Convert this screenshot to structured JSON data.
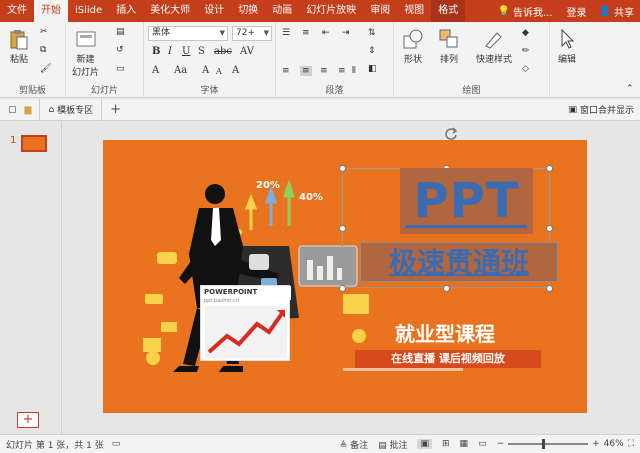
{
  "tabs": [
    {
      "label": "文件",
      "active": false
    },
    {
      "label": "开始",
      "active": true
    },
    {
      "label": "iSlide",
      "active": false
    },
    {
      "label": "插入",
      "active": false
    },
    {
      "label": "美化大师",
      "active": false
    },
    {
      "label": "设计",
      "active": false
    },
    {
      "label": "切换",
      "active": false
    },
    {
      "label": "动画",
      "active": false
    },
    {
      "label": "幻灯片放映",
      "active": false
    },
    {
      "label": "审阅",
      "active": false
    },
    {
      "label": "视图",
      "active": false
    },
    {
      "label": "格式",
      "active": false
    }
  ],
  "tell_me": "告诉我...",
  "sign_in": "登录",
  "share": "共享",
  "ribbon": {
    "paste": "粘贴",
    "clipboard": "剪贴板",
    "new_slide_line1": "新建",
    "new_slide_line2": "幻灯片",
    "slides": "幻灯片",
    "font_name": "黑体",
    "font_size": "72+",
    "font": "字体",
    "paragraph": "段落",
    "shape": "形状",
    "arrange": "排列",
    "quick_styles": "快速样式",
    "drawing": "绘图",
    "edit": "编辑"
  },
  "qbar": {
    "template_tab": "模板专区",
    "merge_window": "窗口合并显示"
  },
  "thumbnail": {
    "num": "1",
    "add": "+"
  },
  "slide": {
    "title": "PPT",
    "subtitle": "极速贯通班",
    "course": "就业型课程",
    "tagline": "在线直播  课后视频回放",
    "pct_20": "20%",
    "pct_40": "40%",
    "pp_card_title": "POWERPOINT",
    "pp_card_sub": "ppt.baohot.cn"
  },
  "status": {
    "slide_info": "幻灯片 第 1 张，共 1 张",
    "notes": "备注",
    "comments": "批注",
    "zoom": "46%",
    "zoom_value": 0.46
  },
  "colors": {
    "accent": "#c43e1c",
    "slide_bg": "#e8721e",
    "title_blue": "#3b6bb0"
  }
}
